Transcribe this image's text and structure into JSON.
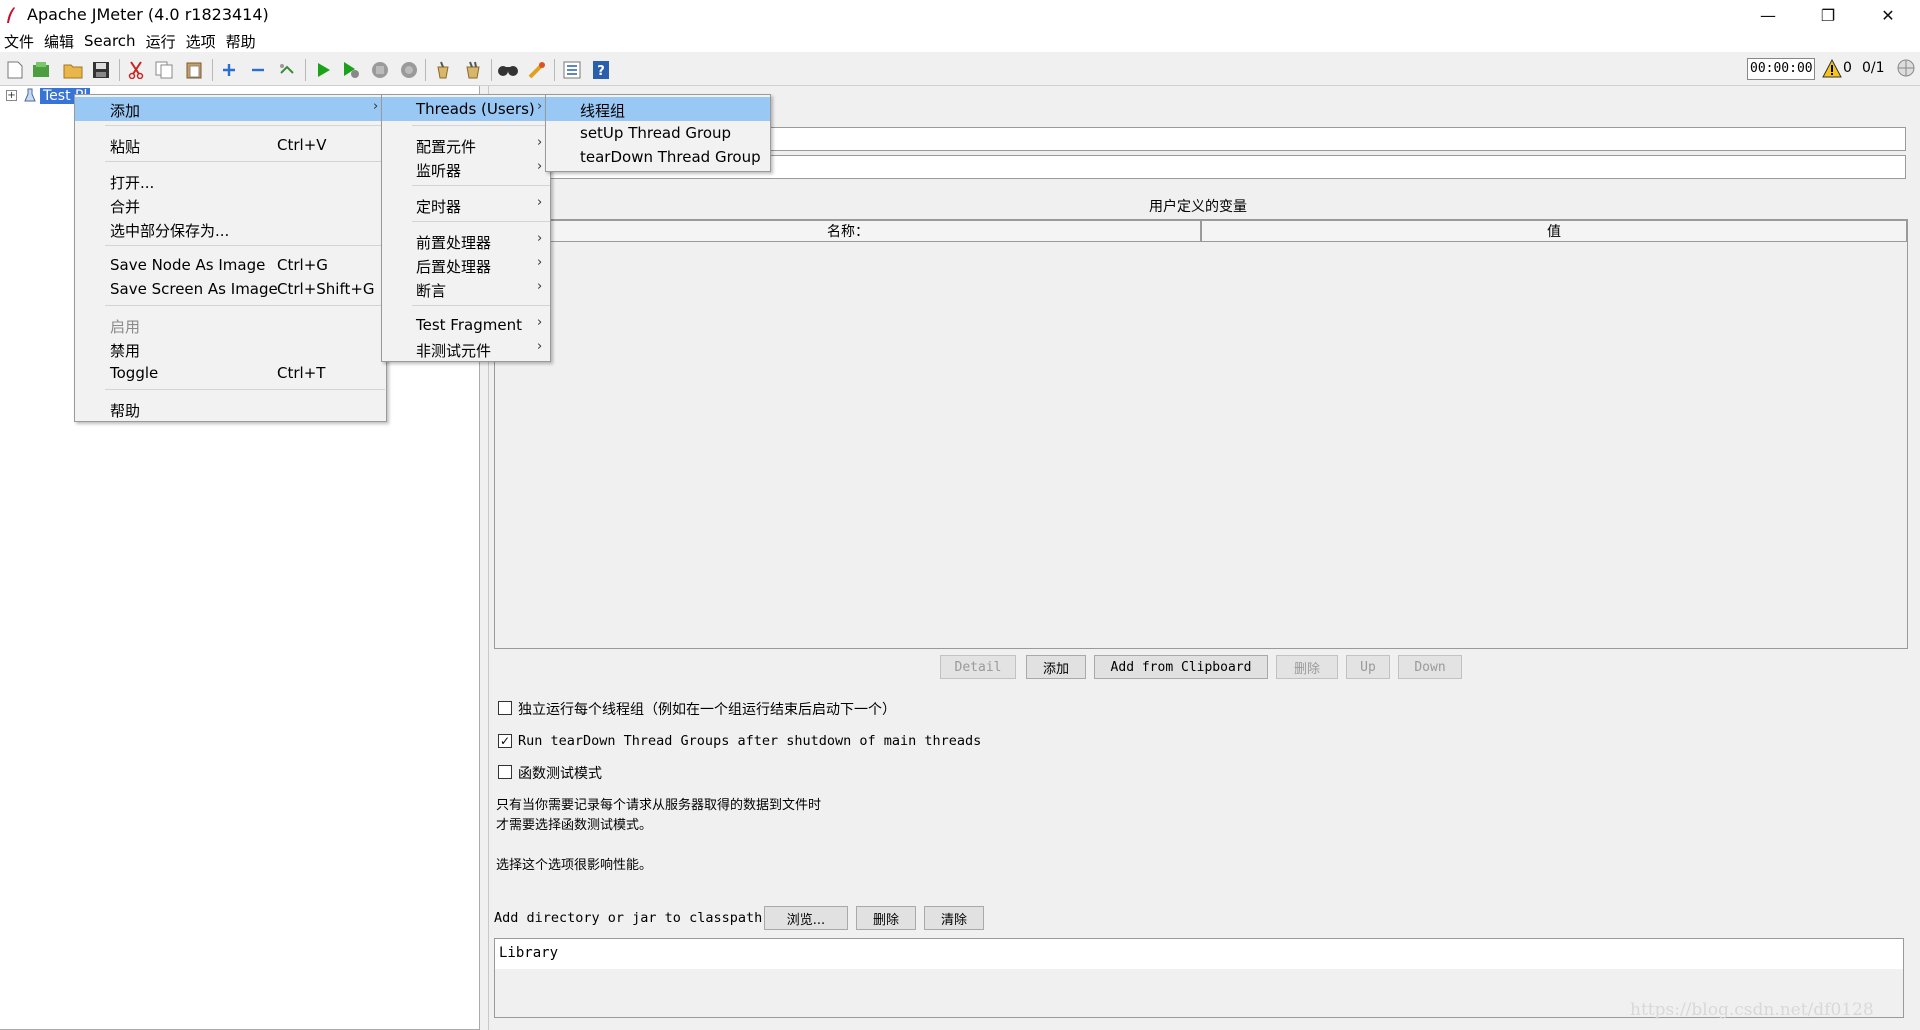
{
  "window": {
    "title": "Apache JMeter (4.0 r1823414)",
    "minimize_glyph": "—",
    "restore_glyph": "❐",
    "close_glyph": "✕"
  },
  "menubar": [
    "文件",
    "编辑",
    "Search",
    "运行",
    "选项",
    "帮助"
  ],
  "toolbar": {
    "icons": [
      "new-icon",
      "templates-icon",
      "open-icon",
      "save-icon",
      "cut-icon",
      "copy-icon",
      "paste-icon",
      "expand-icon",
      "collapse-icon",
      "toggle-icon",
      "start-icon",
      "start-no-pause-icon",
      "stop-icon",
      "shutdown-icon",
      "clear-icon",
      "clear-all-icon",
      "search-icon",
      "reset-search-icon",
      "function-helper-icon",
      "help-icon"
    ],
    "timer": "00:00:00",
    "warning_count": "0",
    "thread_count": "0/1"
  },
  "tree": {
    "expander": "+",
    "node_label": "Test Pl"
  },
  "context_menu": {
    "items": [
      {
        "label": "添加",
        "shortcut": "",
        "submenu": true,
        "highlighted": true
      },
      {
        "label": "粘贴",
        "shortcut": "Ctrl+V"
      },
      {
        "label": "打开...",
        "shortcut": ""
      },
      {
        "label": "合并",
        "shortcut": ""
      },
      {
        "label": "选中部分保存为...",
        "shortcut": ""
      },
      {
        "label": "Save Node As Image",
        "shortcut": "Ctrl+G"
      },
      {
        "label": "Save Screen As Image",
        "shortcut": "Ctrl+Shift+G"
      },
      {
        "label": "启用",
        "shortcut": "",
        "disabled": true
      },
      {
        "label": "禁用",
        "shortcut": ""
      },
      {
        "label": "Toggle",
        "shortcut": "Ctrl+T"
      },
      {
        "label": "帮助",
        "shortcut": ""
      }
    ]
  },
  "add_submenu": {
    "items": [
      {
        "label": "Threads (Users)",
        "highlighted": true
      },
      {
        "label": "配置元件"
      },
      {
        "label": "监听器"
      },
      {
        "label": "定时器"
      },
      {
        "label": "前置处理器"
      },
      {
        "label": "后置处理器"
      },
      {
        "label": "断言"
      },
      {
        "label": "Test Fragment"
      },
      {
        "label": "非测试元件"
      }
    ]
  },
  "threads_submenu": {
    "items": [
      {
        "label": "线程组",
        "highlighted": true
      },
      {
        "label": "setUp Thread Group"
      },
      {
        "label": "tearDown Thread Group"
      }
    ]
  },
  "test_plan": {
    "vars_title": "用户定义的变量",
    "col_name": "名称：",
    "col_value": "值",
    "buttons": {
      "detail": "Detail",
      "add": "添加",
      "add_clipboard": "Add from Clipboard",
      "delete": "删除",
      "up": "Up",
      "down": "Down"
    },
    "chk_serialize": {
      "label": "独立运行每个线程组（例如在一个组运行结束后启动下一个）",
      "checked": false
    },
    "chk_teardown": {
      "label": "Run tearDown Thread Groups after shutdown of main threads",
      "checked": true,
      "mark": "✓"
    },
    "chk_functional": {
      "label": "函数测试模式",
      "checked": false
    },
    "note_line1": "只有当你需要记录每个请求从服务器取得的数据到文件时",
    "note_line2": "才需要选择函数测试模式。",
    "note_line3": "选择这个选项很影响性能。",
    "classpath_label": "Add directory or jar to classpath",
    "browse": "浏览...",
    "cp_delete": "删除",
    "cp_clear": "清除",
    "library_header": "Library"
  },
  "watermark": "https://blog.csdn.net/df0128",
  "colors": {
    "selection": "#3874d8",
    "menu_highlight": "#99c8f5",
    "run_green": "#1aa31a"
  }
}
